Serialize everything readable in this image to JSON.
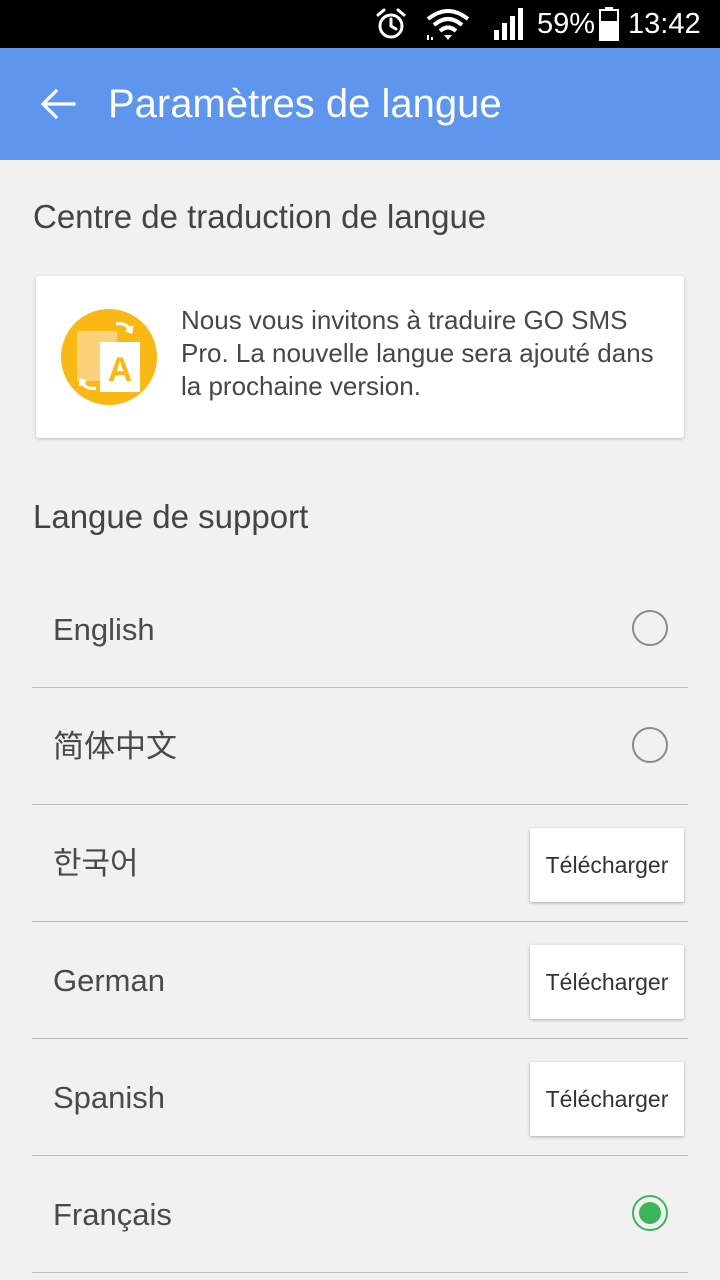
{
  "status_bar": {
    "battery_percent": "59%",
    "time": "13:42",
    "icons": [
      "alarm-icon",
      "wifi-icon",
      "signal-icon",
      "battery-icon"
    ]
  },
  "app_bar": {
    "title": "Paramètres de langue",
    "back_icon": "arrow-left-icon",
    "background": "#5e95ed"
  },
  "translation_center": {
    "header": "Centre de traduction de langue",
    "icon": "translate-icon",
    "message": "Nous vous invitons à traduire GO SMS Pro. La nouvelle langue sera ajouté dans la prochaine version."
  },
  "support": {
    "header": "Langue de support",
    "languages": [
      {
        "label": "English",
        "control": "radio",
        "selected": false
      },
      {
        "label": "简体中文",
        "control": "radio",
        "selected": false
      },
      {
        "label": "한국어",
        "control": "download",
        "button_label": "Télécharger"
      },
      {
        "label": "German",
        "control": "download",
        "button_label": "Télécharger"
      },
      {
        "label": "Spanish",
        "control": "download",
        "button_label": "Télécharger"
      },
      {
        "label": "Français",
        "control": "radio",
        "selected": true
      }
    ]
  },
  "colors": {
    "accent": "#5e95ed",
    "selected_radio": "#3cb55a",
    "icon_yellow": "#f9b814"
  }
}
